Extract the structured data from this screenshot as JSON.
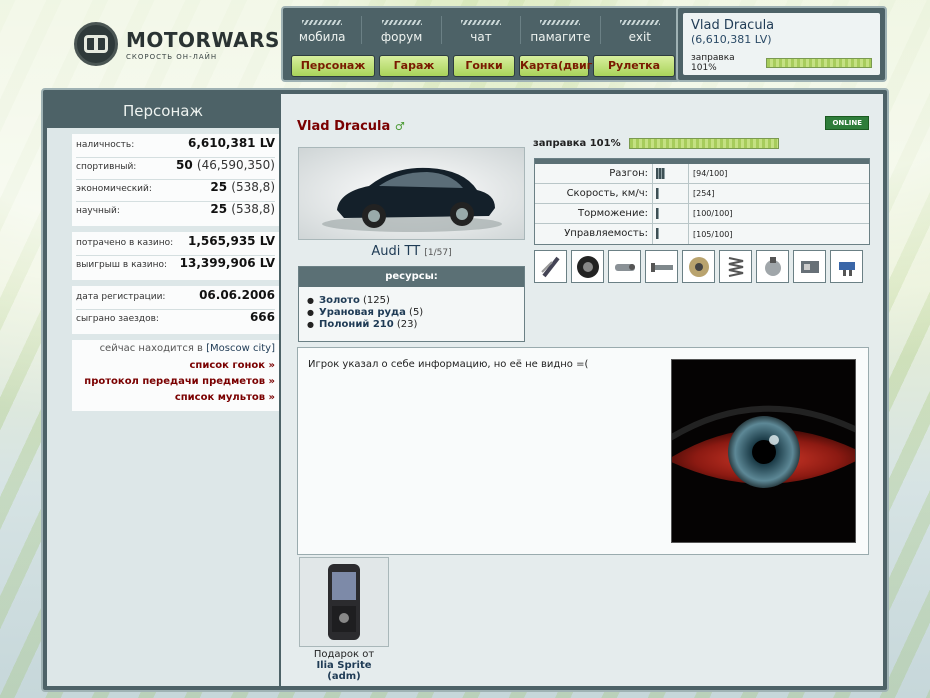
{
  "logo": {
    "title": "MOTORWARS.RU",
    "subtitle": "СКОРОСТЬ ОН-ЛАЙН"
  },
  "nav": {
    "links": [
      "мобила",
      "форум",
      "чат",
      "памагите",
      "exit"
    ],
    "buttons": [
      "Персонаж",
      "Гараж",
      "Гонки",
      "Карта(двиг.)",
      "Рулетка"
    ]
  },
  "userbox": {
    "name": "Vlad Dracula",
    "money": "(6,610,381 LV)",
    "fuel_label": "заправка 101%",
    "fuel_fraction": 1.0
  },
  "left": {
    "title": "Персонаж",
    "block1": [
      {
        "k": "наличность:",
        "v": "6,610,381 LV",
        "p": ""
      },
      {
        "k": "спортивный:",
        "v": "50",
        "p": "(46,590,350)"
      },
      {
        "k": "экономический:",
        "v": "25",
        "p": "(538,8)"
      },
      {
        "k": "научный:",
        "v": "25",
        "p": "(538,8)"
      }
    ],
    "block2": [
      {
        "k": "потрачено в казино:",
        "v": "1,565,935 LV"
      },
      {
        "k": "выигрыш в казино:",
        "v": "13,399,906 LV"
      }
    ],
    "block3": [
      {
        "k": "дата регистрации:",
        "v": "06.06.2006"
      },
      {
        "k": "сыграно заездов:",
        "v": "666"
      }
    ],
    "location_prefix": "сейчас находится в ",
    "location_city": "[Moscow city]",
    "links": [
      "список гонок »",
      "протокол передачи предметов »",
      "список мультов »"
    ]
  },
  "profile": {
    "name": "Vlad Dracula",
    "name_icon": "♂",
    "status": "ONLINE",
    "fuel_label": "заправка 101%",
    "fuel_fraction": 1.0,
    "car_name": "Audi TT",
    "car_count": "[1/57]",
    "resources_title": "ресурсы:",
    "resources": [
      {
        "name": "Золото",
        "qty": "(125)"
      },
      {
        "name": "Урановая руда",
        "qty": "(5)"
      },
      {
        "name": "Полоний 210",
        "qty": "(23)"
      }
    ],
    "stats": [
      {
        "label": "Разгон:",
        "value": "[94/100]",
        "level": 0.94
      },
      {
        "label": "Скорость, км/ч:",
        "value": "[254]",
        "level": 0.3
      },
      {
        "label": "Торможение:",
        "value": "[100/100]",
        "level": 0.3
      },
      {
        "label": "Управляемость:",
        "value": "[105/100]",
        "level": 0.3
      }
    ],
    "parts": [
      "shock-absorber-icon",
      "tire-icon",
      "exhaust-icon",
      "pipe-icon",
      "turbo-icon",
      "spring-icon",
      "pump-icon",
      "ecu-icon",
      "injector-icon"
    ],
    "info_text": "Игрок указал о себе информацию, но её не видно =(",
    "gift_caption": "Подарок от",
    "gift_from": "Ilia Sprite (adm)"
  },
  "colors": {
    "frame": "#4d6267",
    "accent_green": "#a9d35a",
    "link_red": "#7a0000",
    "online_green": "#2e7d3a"
  }
}
